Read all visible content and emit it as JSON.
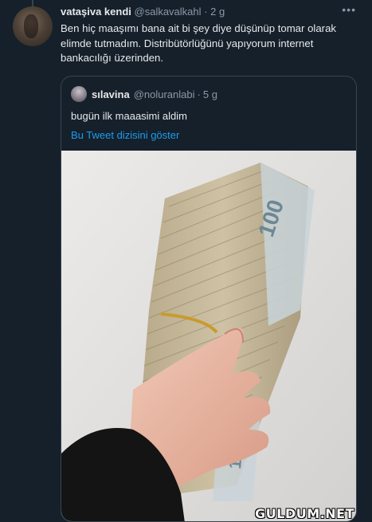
{
  "tweet": {
    "name": "vataşiva kendi",
    "handle": "@salkavalkahl",
    "separator": "·",
    "time": "2 g",
    "more": "•••",
    "text": "Ben hiç maaşımı bana ait bi şey diye düşünüp tomar olarak elimde tutmadım. Distribütörlüğünü yapıyorum internet bankacılığı üzerinden."
  },
  "quote": {
    "name": "sılavina",
    "handle": "@noluranlabi",
    "separator": "·",
    "time": "5 g",
    "text": "bugün ilk maaasimi aldim",
    "show_thread": "Bu Tweet dizisini göster"
  },
  "watermark": "GULDUM.NET",
  "colors": {
    "background": "#15202b",
    "accent": "#1d9bf0",
    "muted": "#8b98a5",
    "border": "#38444d"
  }
}
